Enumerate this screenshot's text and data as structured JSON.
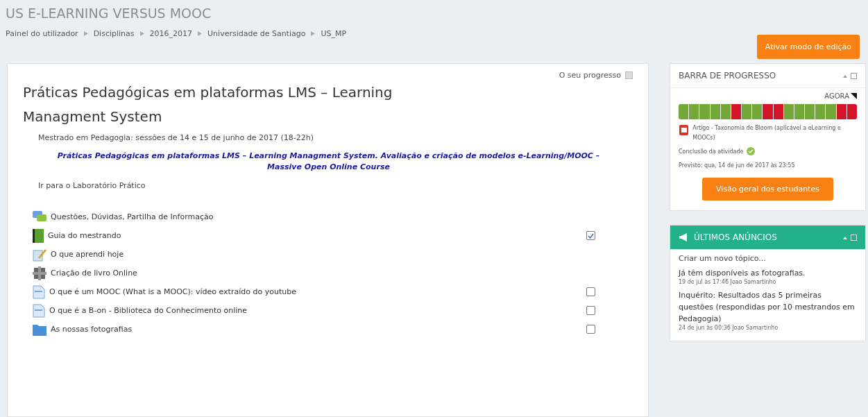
{
  "header": {
    "title": "US E-LEARNING VERSUS MOOC",
    "breadcrumb": [
      "Painel do utilizador",
      "Disciplinas",
      "2016_2017",
      "Universidade de Santiago",
      "US_MP"
    ],
    "edit_button": "Ativar modo de edição"
  },
  "course": {
    "progress_label": "O seu progresso",
    "title": "Práticas Pedagógicas em plataformas LMS – Learning Managment System",
    "subtitle": "Mestrado em Pedagogia: sessões de 14 e 15 de junho de 2017 (18-22h)",
    "highlight": "Práticas Pedagógicas em plataformas LMS – Learning Managment System. Avaliação e criação de modelos e-Learning/MOOC – Massive Open Online Course",
    "lab_link": "Ir para o Laboratório Prático",
    "activities": [
      {
        "kind": "forum",
        "label": "Questões, Dúvidas, Partilha de Informação"
      },
      {
        "kind": "book",
        "label": "Guia do mestrando",
        "checked": true
      },
      {
        "kind": "assignment",
        "label": "O que aprendi hoje"
      },
      {
        "kind": "wiki",
        "label": "Criação de livro Online"
      },
      {
        "kind": "page",
        "label": "O que é um MOOC (What is a MOOC): vídeo extraído do youtube",
        "checked": false
      },
      {
        "kind": "page",
        "label": "O que é a B-on - Biblioteca do Conhecimento online",
        "checked": false
      },
      {
        "kind": "folder",
        "label": "As nossas fotografias",
        "checked": false
      }
    ]
  },
  "progress_block": {
    "title": "BARRA DE PROGRESSO",
    "now_label": "AGORA",
    "segments": [
      {
        "done": true
      },
      {
        "done": true
      },
      {
        "done": true
      },
      {
        "done": true
      },
      {
        "done": true
      },
      {
        "done": false
      },
      {
        "done": true
      },
      {
        "done": true
      },
      {
        "done": false
      },
      {
        "done": false
      },
      {
        "done": true
      },
      {
        "done": true
      },
      {
        "done": true
      },
      {
        "done": true
      },
      {
        "done": true
      },
      {
        "done": false
      },
      {
        "done": false
      }
    ],
    "activity": "Artigo - Taxonomia de Bloom (aplicável a eLearning e MOOCs)",
    "completion": "Conclusão da atividade",
    "expected": "Previsto: qua, 14 de jun de 2017 às 23:55",
    "button": "Visão geral dos estudantes"
  },
  "news_block": {
    "title": "ÚLTIMOS ANÚNCIOS",
    "create": "Criar um novo tópico...",
    "posts": [
      {
        "title": "Já têm disponíveis as fotografias.",
        "meta": "19 de jul às 17:46  Joao Samartinho"
      },
      {
        "title": "Inquérito: Resultados das 5 primeiras questões (respondidas por 10 mestrandos em Pedagogia)",
        "meta": "24 de jun às 00:36  Joao Samartinho"
      }
    ]
  }
}
